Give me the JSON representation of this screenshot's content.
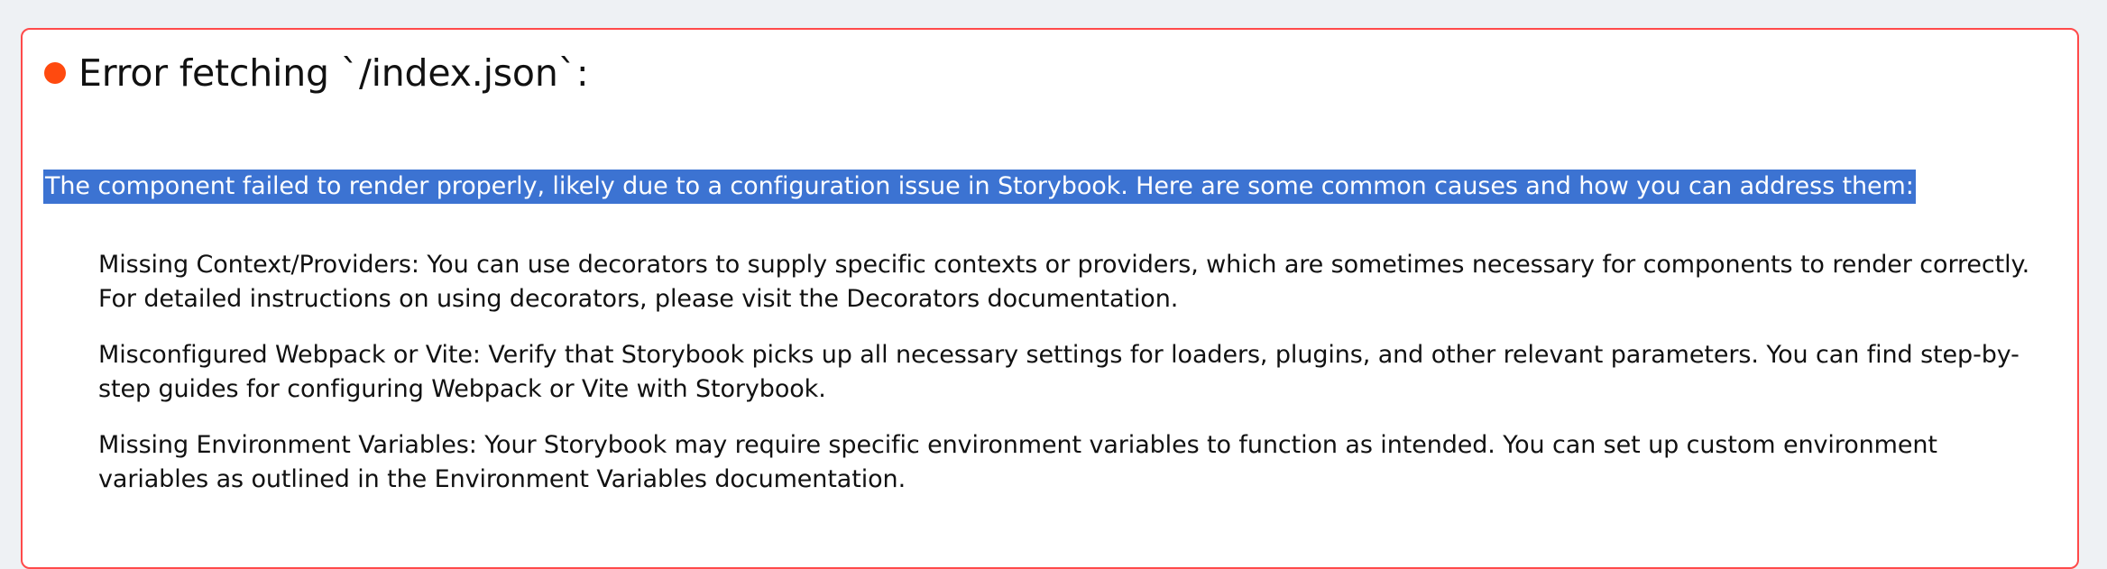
{
  "error": {
    "title": "Error fetching `/index.json`:",
    "indicator_color": "#ff4a0f",
    "border_color": "#ff4a4a",
    "highlight_color": "#3c73d2",
    "intro": "The component failed to render properly, likely due to a configuration issue in Storybook. Here are some common causes and how you can address them:",
    "causes": [
      "Missing Context/Providers: You can use decorators to supply specific contexts or providers, which are sometimes necessary for components to render correctly. For detailed instructions on using decorators, please visit the Decorators documentation.",
      "Misconfigured Webpack or Vite: Verify that Storybook picks up all necessary settings for loaders, plugins, and other relevant parameters. You can find step-by-step guides for configuring Webpack or Vite with Storybook.",
      "Missing Environment Variables: Your Storybook may require specific environment variables to function as intended. You can set up custom environment variables as outlined in the Environment Variables documentation."
    ]
  }
}
